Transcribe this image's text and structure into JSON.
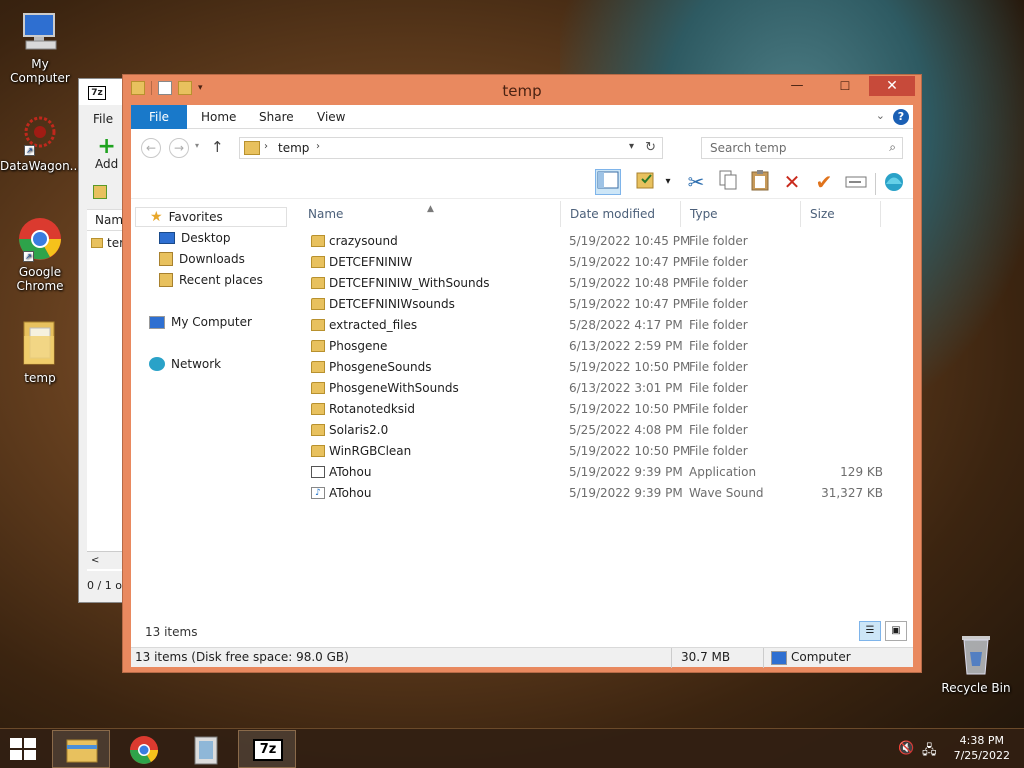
{
  "desktop": {
    "icons": [
      {
        "label": "My Computer",
        "icon": "computer-icon"
      },
      {
        "label": "DataWagon...",
        "icon": "datawagon-icon"
      },
      {
        "label": "Google Chrome",
        "icon": "chrome-icon"
      },
      {
        "label": "temp",
        "icon": "folder-icon"
      },
      {
        "label": "Recycle Bin",
        "icon": "recycle-bin-icon"
      }
    ]
  },
  "zip": {
    "logo": "7z",
    "menu_file": "File",
    "add": "Add",
    "col_name": "Name",
    "item": "ter",
    "status": "0 / 1 o",
    "scroll": "<"
  },
  "explorer": {
    "title": "temp",
    "tabs": [
      "File",
      "Home",
      "Share",
      "View"
    ],
    "address": "temp",
    "search_placeholder": "Search temp",
    "nav": {
      "favorites": "Favorites",
      "desktop": "Desktop",
      "downloads": "Downloads",
      "recent": "Recent places",
      "computer": "My Computer",
      "network": "Network"
    },
    "columns": [
      "Name",
      "Date modified",
      "Type",
      "Size"
    ],
    "rows": [
      {
        "name": "crazysound",
        "date": "5/19/2022 10:45 PM",
        "type": "File folder",
        "size": "",
        "kind": "folder"
      },
      {
        "name": "DETCEFNINIW",
        "date": "5/19/2022 10:47 PM",
        "type": "File folder",
        "size": "",
        "kind": "folder"
      },
      {
        "name": "DETCEFNINIW_WithSounds",
        "date": "5/19/2022 10:48 PM",
        "type": "File folder",
        "size": "",
        "kind": "folder"
      },
      {
        "name": "DETCEFNINIWsounds",
        "date": "5/19/2022 10:47 PM",
        "type": "File folder",
        "size": "",
        "kind": "folder"
      },
      {
        "name": "extracted_files",
        "date": "5/28/2022 4:17 PM",
        "type": "File folder",
        "size": "",
        "kind": "folder"
      },
      {
        "name": "Phosgene",
        "date": "6/13/2022 2:59 PM",
        "type": "File folder",
        "size": "",
        "kind": "folder"
      },
      {
        "name": "PhosgeneSounds",
        "date": "5/19/2022 10:50 PM",
        "type": "File folder",
        "size": "",
        "kind": "folder"
      },
      {
        "name": "PhosgeneWithSounds",
        "date": "6/13/2022 3:01 PM",
        "type": "File folder",
        "size": "",
        "kind": "folder"
      },
      {
        "name": "Rotanotedksid",
        "date": "5/19/2022 10:50 PM",
        "type": "File folder",
        "size": "",
        "kind": "folder"
      },
      {
        "name": "Solaris2.0",
        "date": "5/25/2022 4:08 PM",
        "type": "File folder",
        "size": "",
        "kind": "folder"
      },
      {
        "name": "WinRGBClean",
        "date": "5/19/2022 10:50 PM",
        "type": "File folder",
        "size": "",
        "kind": "folder"
      },
      {
        "name": "ATohou",
        "date": "5/19/2022 9:39 PM",
        "type": "Application",
        "size": "129 KB",
        "kind": "app"
      },
      {
        "name": "ATohou",
        "date": "5/19/2022 9:39 PM",
        "type": "Wave Sound",
        "size": "31,327 KB",
        "kind": "wav"
      }
    ],
    "item_count": "13 items",
    "status_left": "13 items (Disk free space: 98.0 GB)",
    "status_size": "30.7 MB",
    "status_location": "Computer"
  },
  "taskbar": {
    "time": "4:38 PM",
    "date": "7/25/2022"
  }
}
